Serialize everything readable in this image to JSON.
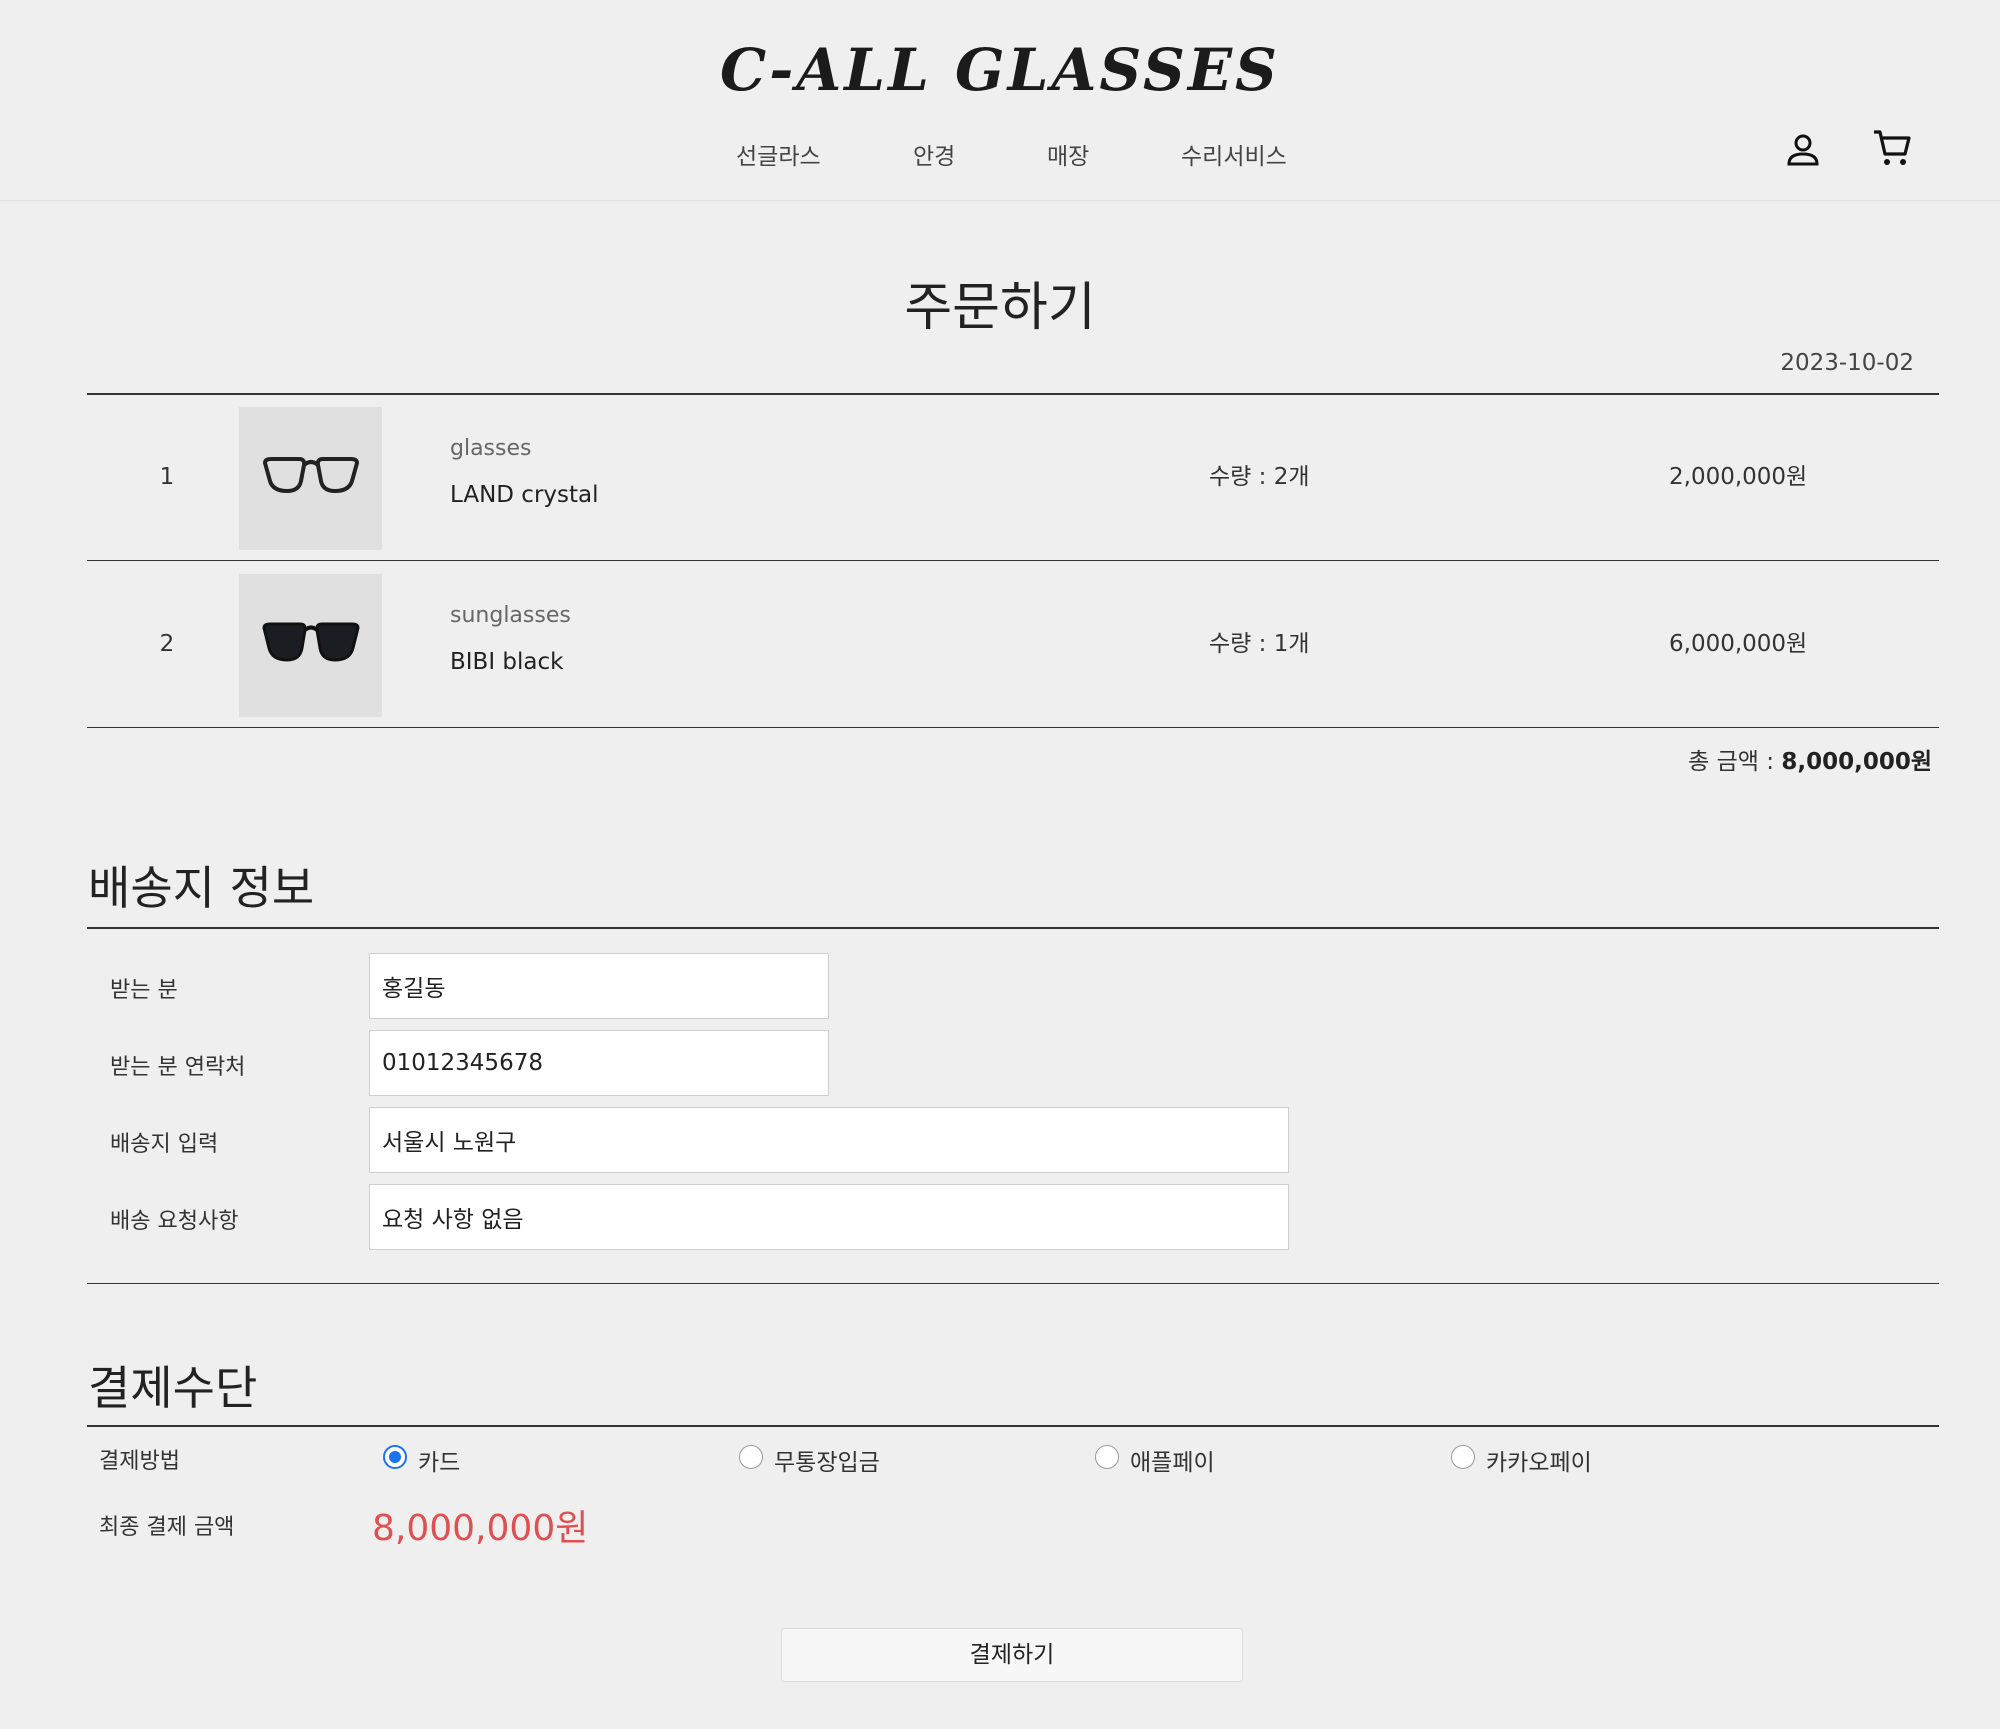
{
  "header": {
    "logo": "C-ALL GLASSES",
    "nav": [
      "선글라스",
      "안경",
      "매장",
      "수리서비스"
    ]
  },
  "order": {
    "title": "주문하기",
    "date": "2023-10-02",
    "items": [
      {
        "num": "1",
        "category": "glasses",
        "name": "LAND crystal",
        "qty": "수량 : 2개",
        "price": "2,000,000원",
        "thumb_icon": "clear-glasses-icon"
      },
      {
        "num": "2",
        "category": "sunglasses",
        "name": "BIBI black",
        "qty": "수량 : 1개",
        "price": "6,000,000원",
        "thumb_icon": "black-sunglasses-icon"
      }
    ],
    "total_label": "총 금액 :",
    "total_value": "8,000,000원"
  },
  "shipping": {
    "title": "배송지 정보",
    "fields": [
      {
        "label": "받는 분",
        "value": "홍길동"
      },
      {
        "label": "받는 분 연락처",
        "value": "01012345678"
      },
      {
        "label": "배송지 입력",
        "value": "서울시 노원구"
      },
      {
        "label": "배송 요청사항",
        "value": "요청 사항 없음"
      }
    ]
  },
  "payment": {
    "title": "결제수단",
    "method_label": "결제방법",
    "methods": [
      "카드",
      "무통장입금",
      "애플페이",
      "카카오페이"
    ],
    "selected": "카드",
    "final_label": "최종 결제 금액",
    "final_amount": "8,000,000원",
    "accent_color": "#e05050",
    "radio_color": "#1a73e8"
  },
  "actions": {
    "pay_button": "결제하기"
  }
}
